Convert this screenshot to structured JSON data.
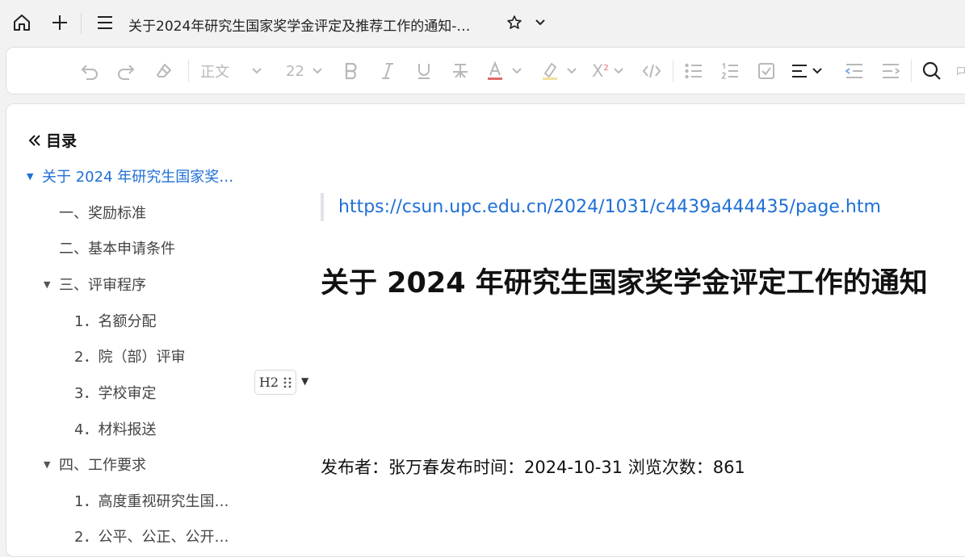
{
  "tabbar": {
    "home_icon": "home-icon",
    "new_icon": "plus-icon",
    "menu_icon": "menu-icon",
    "title": "关于2024年研究生国家奖学金评定及推荐工作的通知-…",
    "star_icon": "star-icon",
    "dropdown_icon": "chevron-down-icon"
  },
  "toolbar": {
    "style_label": "正文",
    "font_size": "22",
    "superscript_label": "X",
    "superscript_mark": "2"
  },
  "toc": {
    "title": "目录",
    "items": [
      {
        "label": "关于 2024 年研究生国家奖…"
      },
      {
        "label": "一、奖励标准"
      },
      {
        "label": "二、基本申请条件"
      },
      {
        "label": "三、评审程序"
      },
      {
        "label": "1．名额分配"
      },
      {
        "label": "2．院（部）评审"
      },
      {
        "label": "3．学校审定"
      },
      {
        "label": "4．材料报送"
      },
      {
        "label": "四、工作要求"
      },
      {
        "label": "1．高度重视研究生国…"
      },
      {
        "label": "2．公平、公正、公开…"
      }
    ]
  },
  "document": {
    "source_link": "https://csun.upc.edu.cn/2024/1031/c4439a444435/page.htm",
    "heading": "关于 2024 年研究生国家奖学金评定工作的通知",
    "block_handle_label": "H2",
    "meta_line": "发布者：张万春发布时间：2024-10-31 浏览次数：861"
  },
  "colors": {
    "accent": "#1f6fd6",
    "toolbar_disabled": "#b8b8b8",
    "text": "#111111"
  }
}
